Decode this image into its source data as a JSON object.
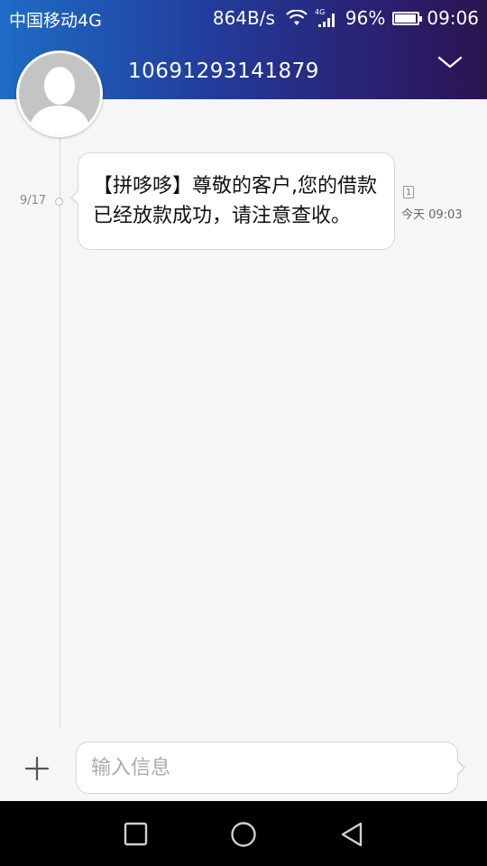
{
  "status_bar": {
    "carrier": "中国移动4G",
    "speed": "864B/s",
    "network": "4G",
    "battery_percent": "96%",
    "battery_level": 0.96,
    "time": "09:06"
  },
  "header": {
    "contact": "10691293141879",
    "expand_icon": "chevron-down-icon"
  },
  "conversation": {
    "date_label": "9/17",
    "messages": [
      {
        "text": "【拼哆哆】尊敬的客户,您的借款已经放款成功，请注意查收。",
        "sim": "1",
        "time": "今天 09:03"
      }
    ]
  },
  "composer": {
    "placeholder": "输入信息",
    "attach_icon": "plus-icon"
  },
  "nav": {
    "square_icon": "recent-apps-icon",
    "circle_icon": "home-icon",
    "triangle_icon": "back-icon"
  },
  "colors": {
    "header_start": "#1e6cc6",
    "header_end": "#2a1450",
    "background": "#f6f6f6"
  }
}
